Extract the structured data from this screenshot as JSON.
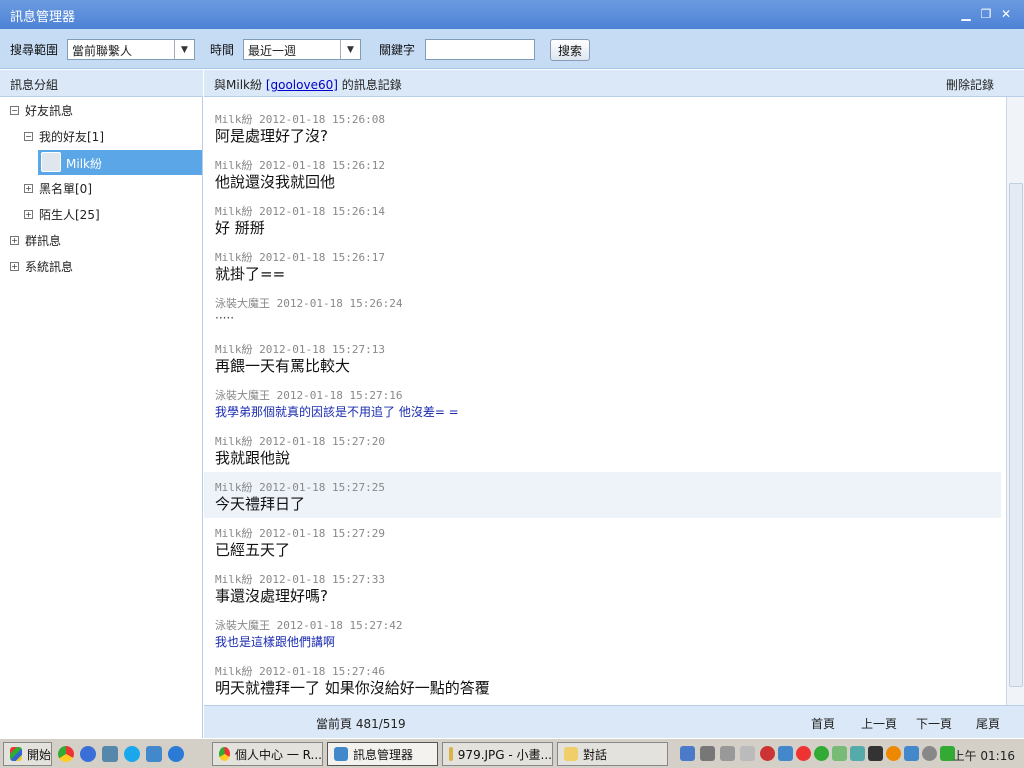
{
  "window": {
    "title": "訊息管理器"
  },
  "search": {
    "scope_label": "搜尋範圍",
    "scope_value": "當前聯繫人",
    "time_label": "時間",
    "time_value": "最近一週",
    "keyword_label": "關鍵字",
    "keyword_value": "",
    "search_button": "搜索"
  },
  "sidebar": {
    "header": "訊息分組",
    "friends": "好友訊息",
    "my_friends": "我的好友[1]",
    "selected_contact": "Milk紛",
    "blacklist": "黑名單[0]",
    "strangers": "陌生人[25]",
    "groups": "群訊息",
    "system": "系統訊息"
  },
  "chat": {
    "header_prefix": "與Milk紛",
    "header_link": "[goolove60]",
    "header_suffix": "的訊息記錄",
    "delete_label": "刪除記錄",
    "messages": [
      {
        "sender": "Milk紛",
        "time": "2012-01-18 15:26:08",
        "text": "阿是處理好了沒?",
        "style": "large"
      },
      {
        "sender": "Milk紛",
        "time": "2012-01-18 15:26:12",
        "text": "他說還沒我就回他",
        "style": "large"
      },
      {
        "sender": "Milk紛",
        "time": "2012-01-18 15:26:14",
        "text": "好 掰掰",
        "style": "large"
      },
      {
        "sender": "Milk紛",
        "time": "2012-01-18 15:26:17",
        "text": "就掛了==",
        "style": "large"
      },
      {
        "sender": "泳裝大魔王",
        "time": "2012-01-18 15:26:24",
        "text": "·····",
        "style": "small"
      },
      {
        "sender": "Milk紛",
        "time": "2012-01-18 15:27:13",
        "text": "再餵一天有罵比較大",
        "style": "large"
      },
      {
        "sender": "泳裝大魔王",
        "time": "2012-01-18 15:27:16",
        "text": "我學弟那個就真的因該是不用追了 他沒差= =",
        "style": "blue"
      },
      {
        "sender": "Milk紛",
        "time": "2012-01-18 15:27:20",
        "text": "我就跟他說",
        "style": "large"
      },
      {
        "sender": "Milk紛",
        "time": "2012-01-18 15:27:25",
        "text": "今天禮拜日了",
        "style": "large"
      },
      {
        "sender": "Milk紛",
        "time": "2012-01-18 15:27:29",
        "text": "已經五天了",
        "style": "large"
      },
      {
        "sender": "Milk紛",
        "time": "2012-01-18 15:27:33",
        "text": "事還沒處理好嗎?",
        "style": "large"
      },
      {
        "sender": "泳裝大魔王",
        "time": "2012-01-18 15:27:42",
        "text": "我也是這樣跟他們講啊",
        "style": "blue"
      },
      {
        "sender": "Milk紛",
        "time": "2012-01-18 15:27:46",
        "text": "明天就禮拜一了 如果你沒給好一點的答覆",
        "style": "large"
      }
    ]
  },
  "pager": {
    "current": "當前頁 481/519",
    "first": "首頁",
    "prev": "上一頁",
    "next": "下一頁",
    "last": "尾頁"
  },
  "taskbar": {
    "start": "開始",
    "items": [
      "個人中心 一 R...",
      "訊息管理器",
      "979.JPG - 小畫...",
      "對話"
    ],
    "clock": "上午 01:16"
  }
}
